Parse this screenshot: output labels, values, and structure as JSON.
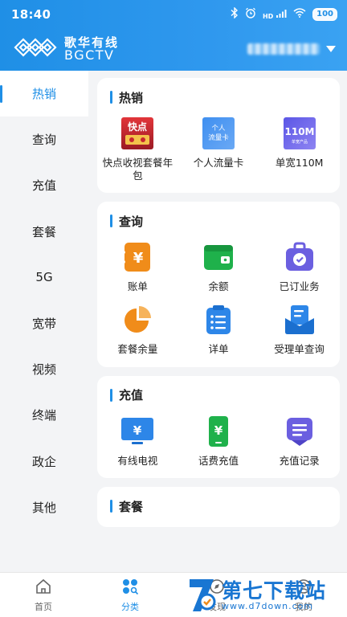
{
  "status": {
    "time": "18:40",
    "signal_label": "HD",
    "battery": "100"
  },
  "header": {
    "brand_cn": "歌华有线",
    "brand_en": "BGCTV"
  },
  "sidebar": {
    "items": [
      {
        "label": "热销"
      },
      {
        "label": "查询"
      },
      {
        "label": "充值"
      },
      {
        "label": "套餐"
      },
      {
        "label": "5G"
      },
      {
        "label": "宽带"
      },
      {
        "label": "视频"
      },
      {
        "label": "终端"
      },
      {
        "label": "政企"
      },
      {
        "label": "其他"
      }
    ]
  },
  "sections": {
    "hot": {
      "title": "热销",
      "items": [
        {
          "label": "快点收视套餐年包",
          "icon": "kuaidian-package-icon",
          "badge": "快点"
        },
        {
          "label": "个人流量卡",
          "icon": "data-card-icon",
          "badge": "个人\n流量卡"
        },
        {
          "label": "单宽110M",
          "icon": "broadband-110m-icon",
          "badge": "110M",
          "sub": "单宽产品"
        }
      ]
    },
    "query": {
      "title": "查询",
      "items": [
        {
          "label": "账单",
          "icon": "bill-icon"
        },
        {
          "label": "余额",
          "icon": "wallet-icon"
        },
        {
          "label": "已订业务",
          "icon": "subscribed-bag-icon"
        },
        {
          "label": "套餐余量",
          "icon": "pie-chart-icon"
        },
        {
          "label": "详单",
          "icon": "checklist-icon"
        },
        {
          "label": "受理单查询",
          "icon": "order-envelope-icon"
        }
      ]
    },
    "recharge": {
      "title": "充值",
      "items": [
        {
          "label": "有线电视",
          "icon": "tv-yen-icon"
        },
        {
          "label": "话费充值",
          "icon": "phone-yen-icon"
        },
        {
          "label": "充值记录",
          "icon": "record-icon"
        }
      ]
    },
    "package": {
      "title": "套餐"
    }
  },
  "tabbar": {
    "items": [
      {
        "label": "首页"
      },
      {
        "label": "分类"
      },
      {
        "label": "发现"
      },
      {
        "label": "我的"
      }
    ]
  },
  "watermark": {
    "cn": "第七下载站",
    "url": "www.d7down.com"
  },
  "colors": {
    "primary": "#1f8fe6",
    "orange": "#f08c1a",
    "green": "#1fb14b",
    "purple": "#6b5fe0",
    "blue": "#2d86e8"
  }
}
